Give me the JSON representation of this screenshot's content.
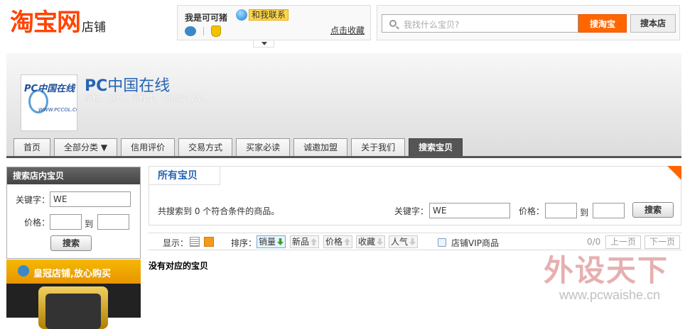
{
  "header": {
    "logo_main": "淘宝网",
    "logo_sub": "店铺",
    "seller_name": "我是可可猪",
    "contact_label": "和我联系",
    "favorite_link": "点击收藏",
    "search_placeholder": "我找什么宝贝?",
    "search_taobao_label": "搜淘宝",
    "search_shop_label": "搜本店"
  },
  "shop": {
    "logo_text_main": "PC中国在线",
    "logo_text_url": "WWW.PCCOL.COM",
    "title_prefix": "PC",
    "title_cn": "中国在线",
    "description": "鼠标，键盘，鼠标垫，网络设备等。。",
    "nav": [
      {
        "label": "首页"
      },
      {
        "label": "全部分类 ▼"
      },
      {
        "label": "信用评价"
      },
      {
        "label": "交易方式"
      },
      {
        "label": "买家必读"
      },
      {
        "label": "诚邀加盟"
      },
      {
        "label": "关于我们"
      },
      {
        "label": "搜索宝贝",
        "active": true
      }
    ]
  },
  "left_search": {
    "heading": "搜索店内宝贝",
    "keyword_label": "关键字：",
    "keyword_value": "WE",
    "price_label": "价格：",
    "to_label": "到",
    "price_min": "",
    "price_max": "",
    "button_label": "搜索"
  },
  "promo": {
    "text": "皇冠店铺,放心购买"
  },
  "main": {
    "title": "所有宝贝",
    "result_text": "共搜索到 0 个符合条件的商品。",
    "keyword_label": "关键字：",
    "keyword_value": "WE",
    "price_label": "价格：",
    "to_label": "到",
    "price_min": "",
    "price_max": "",
    "button_label": "搜索"
  },
  "toolbar": {
    "display_label": "显示：",
    "sort_label": "排序：",
    "sorts": [
      {
        "label": "销量",
        "active": true
      },
      {
        "label": "新品"
      },
      {
        "label": "价格"
      },
      {
        "label": "收藏"
      },
      {
        "label": "人气"
      }
    ],
    "vip_label": "店铺VIP商品",
    "page_count": "0/0",
    "prev_label": "上一页",
    "next_label": "下一页"
  },
  "no_result": "没有对应的宝贝",
  "watermark": {
    "text": "外设天下",
    "url": "www.pcwaishe.cn"
  }
}
